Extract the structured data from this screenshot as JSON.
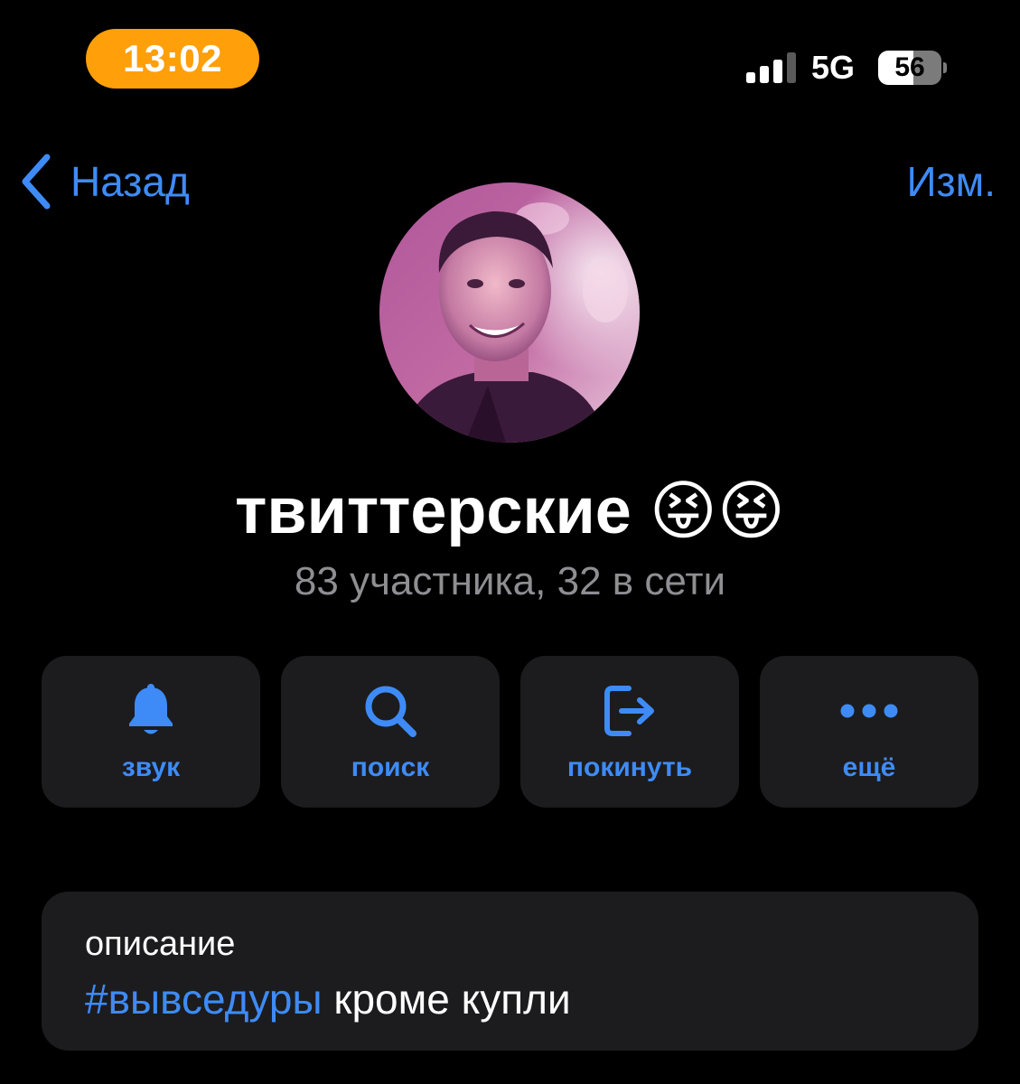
{
  "status_bar": {
    "time": "13:02",
    "network": "5G",
    "battery": "56",
    "battery_level": 0.56
  },
  "nav": {
    "back_label": "Назад",
    "edit_label": "Изм."
  },
  "profile": {
    "title": "твиттерские 😝😝",
    "subtitle": "83 участника, 32 в сети"
  },
  "actions": [
    {
      "label": "звук",
      "icon": "bell-icon"
    },
    {
      "label": "поиск",
      "icon": "search-icon"
    },
    {
      "label": "покинуть",
      "icon": "leave-icon"
    },
    {
      "label": "ещё",
      "icon": "more-icon"
    }
  ],
  "description": {
    "label": "описание",
    "hashtag": "#вывседуры",
    "text": " кроме купли"
  },
  "colors": {
    "accent": "#3E8BF7",
    "time_pill": "#FF9F0A",
    "card": "#1C1C1E",
    "secondary_text": "#8E8E93"
  }
}
